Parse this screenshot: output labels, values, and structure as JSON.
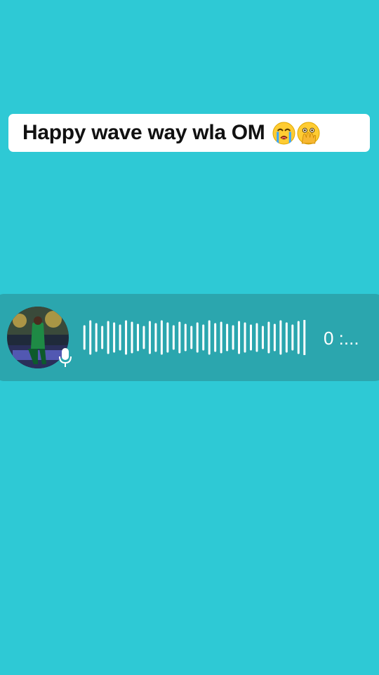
{
  "colors": {
    "background": "#2ec9d5",
    "voice_bar": "#2ba6ae",
    "caption_bg": "#ffffff",
    "caption_text": "#111111",
    "wave": "#ffffff",
    "time_text": "#ffffff"
  },
  "caption": {
    "text": "Happy wave way wla OM",
    "emojis": [
      "loudly-crying-face-icon",
      "face-with-open-eyes-and-hand-over-mouth-icon"
    ]
  },
  "voice_message": {
    "avatar": "player-avatar",
    "mic_icon": "microphone-icon",
    "duration": "0 :..."
  }
}
